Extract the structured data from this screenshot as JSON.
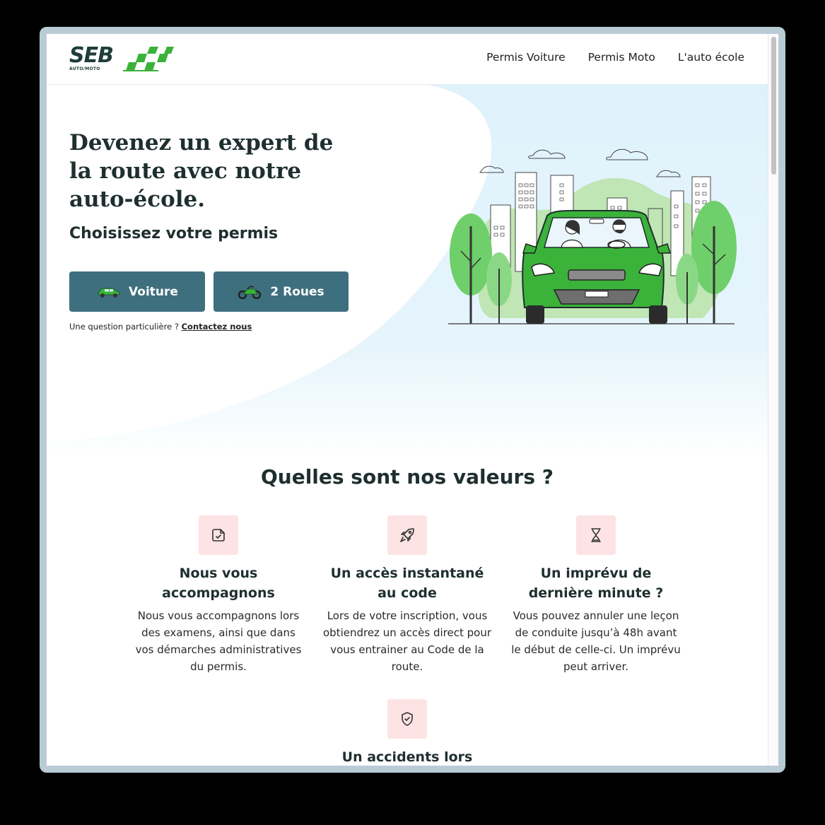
{
  "header": {
    "logo_text": "SEB",
    "logo_sub": "AUTO/MOTO",
    "nav": [
      "Permis Voiture",
      "Permis Moto",
      "L'auto école"
    ]
  },
  "hero": {
    "title": "Devenez un expert de la route avec notre auto-école.",
    "subtitle": "Choisissez votre permis",
    "buttons": [
      {
        "label": "Voiture",
        "icon": "car-icon"
      },
      {
        "label": "2 Roues",
        "icon": "motorbike-icon"
      }
    ],
    "question": "Une question particulière ?",
    "contact_link": "Contactez nous"
  },
  "values": {
    "title": "Quelles sont nos valeurs ?",
    "items": [
      {
        "icon": "document-check-icon",
        "heading": "Nous vous accompagnons",
        "text": "Nous vous accompagnons lors des examens, ainsi que dans vos démarches administratives du permis."
      },
      {
        "icon": "rocket-icon",
        "heading": "Un accès instantané au code",
        "text": "Lors de votre inscription, vous obtiendrez un accès direct pour vous entrainer au Code de la route."
      },
      {
        "icon": "hourglass-icon",
        "heading": "Un imprévu de dernière minute ?",
        "text": "Vous pouvez annuler une leçon de conduite jusqu’à 48h avant le début de celle-ci. Un imprévu peut arriver."
      },
      {
        "icon": "shield-check-icon",
        "heading": "Un accidents lors",
        "text": ""
      }
    ]
  },
  "colors": {
    "button": "#3e6f7f",
    "accent_green": "#3bb23a",
    "icon_bg": "#fde3e4",
    "hero_bg": "#dff2fb"
  }
}
